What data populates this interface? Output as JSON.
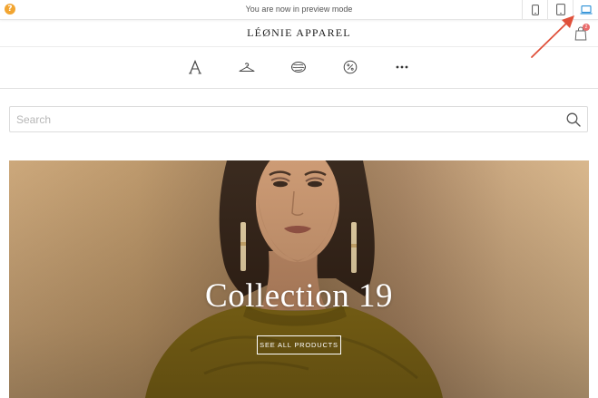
{
  "preview_bar": {
    "help_icon": "help-circle-icon",
    "text": "You are now in preview mode",
    "devices": [
      {
        "name": "mobile",
        "icon": "smartphone-icon"
      },
      {
        "name": "tablet",
        "icon": "tablet-icon"
      },
      {
        "name": "desktop",
        "icon": "laptop-icon",
        "active": true
      }
    ],
    "active_color": "#2a8fd6"
  },
  "store": {
    "logo": "LÉØNIE APPAREL",
    "cart_icon": "shopping-bag-icon",
    "cart_count": "2",
    "badge_color": "#e96b6b"
  },
  "category_nav": [
    {
      "icon": "letter-a-icon"
    },
    {
      "icon": "clothes-hanger-icon"
    },
    {
      "icon": "yarn-ball-icon"
    },
    {
      "icon": "percent-badge-icon"
    },
    {
      "icon": "more-dots-icon"
    }
  ],
  "search": {
    "placeholder": "Search",
    "icon": "search-icon"
  },
  "hero": {
    "title": "Collection 19",
    "button_label": "SEE ALL PRODUCTS"
  },
  "annotation": {
    "icon": "red-arrow-icon",
    "color": "#e0503a"
  }
}
